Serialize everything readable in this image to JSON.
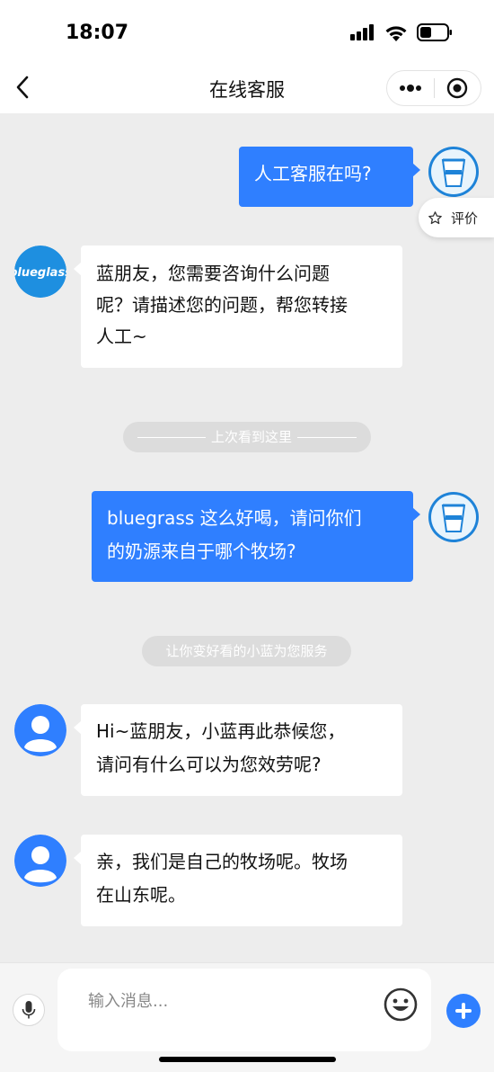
{
  "status_bar": {
    "time": "18:07"
  },
  "nav": {
    "title": "在线客服"
  },
  "rate": {
    "label": "评价"
  },
  "messages": [
    {
      "text": "人工客服在吗?"
    },
    {
      "text_lines": [
        "蓝朋友，您需要咨询什么问题",
        "呢？请描述您的问题，帮您转接",
        "人工~"
      ]
    },
    {
      "text_lines": [
        "bluegrass 这么好喝，请问你们",
        "的奶源来自于哪个牧场?"
      ]
    },
    {
      "text_lines": [
        "Hi~蓝朋友，小蓝再此恭候您，",
        "请问有什么可以为您效劳呢?"
      ]
    },
    {
      "text_lines": [
        "亲，我们是自己的牧场呢。牧场",
        "在山东呢。"
      ]
    }
  ],
  "system": {
    "last_seen": "上次看到这里",
    "service_notice": "让你变好看的小蓝为您服务"
  },
  "brand": {
    "logo_text": "blueglass"
  },
  "input": {
    "placeholder": "输入消息..."
  },
  "colors": {
    "accent": "#2f7fff",
    "background": "#ededed"
  }
}
